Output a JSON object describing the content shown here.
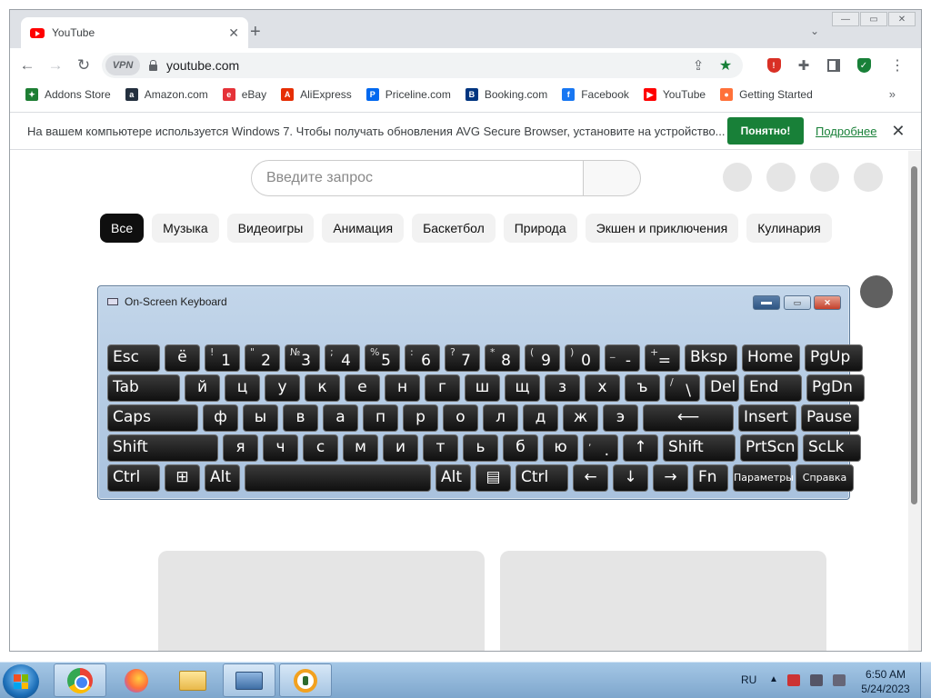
{
  "browser": {
    "tab_title": "YouTube",
    "tab_close": "✕",
    "new_tab": "+",
    "tab_list": "⌄",
    "url": "youtube.com",
    "vpn": "VPN",
    "window_buttons": {
      "minimize": "—",
      "maximize": "▭",
      "close": "✕"
    }
  },
  "bookmarks": [
    {
      "label": "Addons Store",
      "icon": "addons-store-icon",
      "color": "#1e7e34",
      "glyph": "✦"
    },
    {
      "label": "Amazon.com",
      "icon": "amazon-icon",
      "color": "#232f3e",
      "glyph": "a"
    },
    {
      "label": "eBay",
      "icon": "ebay-icon",
      "color": "#e53238",
      "glyph": "e"
    },
    {
      "label": "AliExpress",
      "icon": "aliexpress-icon",
      "color": "#e62e04",
      "glyph": "A"
    },
    {
      "label": "Priceline.com",
      "icon": "priceline-icon",
      "color": "#0068ef",
      "glyph": "P"
    },
    {
      "label": "Booking.com",
      "icon": "booking-icon",
      "color": "#003580",
      "glyph": "B"
    },
    {
      "label": "Facebook",
      "icon": "facebook-icon",
      "color": "#1877f2",
      "glyph": "f"
    },
    {
      "label": "YouTube",
      "icon": "youtube-icon",
      "color": "#ff0000",
      "glyph": "▶"
    },
    {
      "label": "Getting Started",
      "icon": "firefox-icon",
      "color": "#ff7139",
      "glyph": "●"
    }
  ],
  "bookmarks_more": "»",
  "infobar": {
    "text": "На вашем компьютере используется Windows 7. Чтобы получать обновления AVG Secure Browser, установите на устройство...",
    "ok_label": "Понятно!",
    "more_label": "Подробнее",
    "close": "✕"
  },
  "youtube": {
    "search_placeholder": "Введите запрос",
    "chips": [
      "Все",
      "Музыка",
      "Видеоигры",
      "Анимация",
      "Баскетбол",
      "Природа",
      "Экшен и приключения",
      "Кулинария"
    ]
  },
  "osk": {
    "title": "On-Screen Keyboard",
    "rows": [
      [
        {
          "label": "Esc"
        },
        {
          "label": "ё"
        },
        {
          "sub": "!",
          "label": "1"
        },
        {
          "sub": "\"",
          "label": "2"
        },
        {
          "sub": "№",
          "label": "3"
        },
        {
          "sub": ";",
          "label": "4"
        },
        {
          "sub": "%",
          "label": "5"
        },
        {
          "sub": ":",
          "label": "6"
        },
        {
          "sub": "?",
          "label": "7"
        },
        {
          "sub": "*",
          "label": "8"
        },
        {
          "sub": "(",
          "label": "9"
        },
        {
          "sub": ")",
          "label": "0"
        },
        {
          "sub": "_",
          "label": "-"
        },
        {
          "sub": "+",
          "label": "="
        },
        {
          "label": "Bksp"
        },
        {
          "label": "Home"
        },
        {
          "label": "PgUp"
        }
      ],
      [
        {
          "label": "Tab"
        },
        {
          "label": "й"
        },
        {
          "label": "ц"
        },
        {
          "label": "у"
        },
        {
          "label": "к"
        },
        {
          "label": "е"
        },
        {
          "label": "н"
        },
        {
          "label": "г"
        },
        {
          "label": "ш"
        },
        {
          "label": "щ"
        },
        {
          "label": "з"
        },
        {
          "label": "х"
        },
        {
          "label": "ъ"
        },
        {
          "sub": "/",
          "label": "\\"
        },
        {
          "label": "Del"
        },
        {
          "label": "End"
        },
        {
          "label": "PgDn"
        }
      ],
      [
        {
          "label": "Caps"
        },
        {
          "label": "ф"
        },
        {
          "label": "ы"
        },
        {
          "label": "в"
        },
        {
          "label": "а"
        },
        {
          "label": "п"
        },
        {
          "label": "р"
        },
        {
          "label": "о"
        },
        {
          "label": "л"
        },
        {
          "label": "д"
        },
        {
          "label": "ж"
        },
        {
          "label": "э"
        },
        {
          "label": "⟵"
        },
        {
          "label": "Insert"
        },
        {
          "label": "Pause"
        }
      ],
      [
        {
          "label": "Shift"
        },
        {
          "label": "я"
        },
        {
          "label": "ч"
        },
        {
          "label": "с"
        },
        {
          "label": "м"
        },
        {
          "label": "и"
        },
        {
          "label": "т"
        },
        {
          "label": "ь"
        },
        {
          "label": "б"
        },
        {
          "label": "ю"
        },
        {
          "sub": ",",
          "label": "."
        },
        {
          "label": "↑"
        },
        {
          "label": "Shift"
        },
        {
          "label": "PrtScn"
        },
        {
          "label": "ScLk"
        }
      ],
      [
        {
          "label": "Ctrl"
        },
        {
          "label": "⊞"
        },
        {
          "label": "Alt"
        },
        {
          "label": ""
        },
        {
          "label": "Alt"
        },
        {
          "label": "▤"
        },
        {
          "label": "Ctrl"
        },
        {
          "label": "←"
        },
        {
          "label": "↓"
        },
        {
          "label": "→"
        },
        {
          "label": "Fn"
        },
        {
          "label": "Параметры"
        },
        {
          "label": "Справка"
        }
      ]
    ]
  },
  "taskbar": {
    "language": "RU",
    "time": "6:50 AM",
    "date": "5/24/2023",
    "apps": [
      "chrome-icon",
      "firefox-icon",
      "explorer-icon",
      "on-screen-keyboard-icon",
      "avg-browser-icon"
    ]
  }
}
